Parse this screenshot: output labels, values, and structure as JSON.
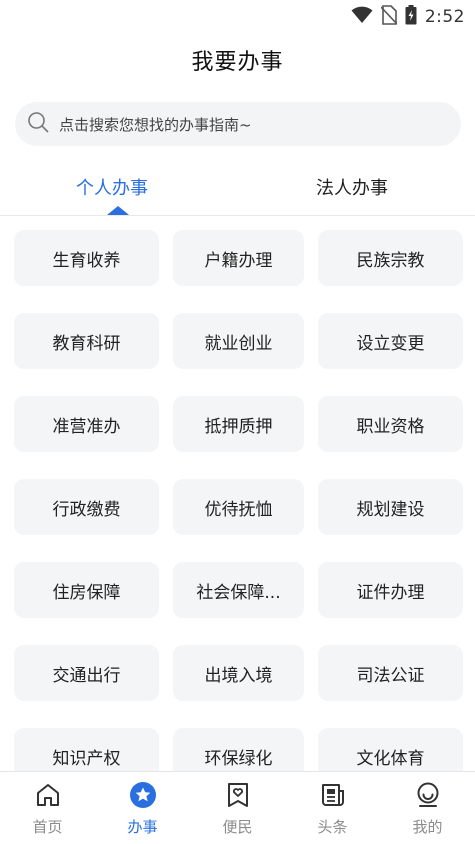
{
  "status_bar": {
    "time": "2:52"
  },
  "header": {
    "title": "我要办事"
  },
  "search": {
    "placeholder": "点击搜索您想找的办事指南~"
  },
  "tabs": [
    {
      "label": "个人办事",
      "active": true
    },
    {
      "label": "法人办事",
      "active": false
    }
  ],
  "services": [
    "生育收养",
    "户籍办理",
    "民族宗教",
    "教育科研",
    "就业创业",
    "设立变更",
    "准营准办",
    "抵押质押",
    "职业资格",
    "行政缴费",
    "优待抚恤",
    "规划建设",
    "住房保障",
    "社会保障...",
    "证件办理",
    "交通出行",
    "出境入境",
    "司法公证",
    "知识产权",
    "环保绿化",
    "文化体育"
  ],
  "bottom_nav": [
    {
      "label": "首页",
      "icon": "home-icon",
      "active": false
    },
    {
      "label": "办事",
      "icon": "star-icon",
      "active": true
    },
    {
      "label": "便民",
      "icon": "heart-bookmark-icon",
      "active": false
    },
    {
      "label": "头条",
      "icon": "news-icon",
      "active": false
    },
    {
      "label": "我的",
      "icon": "profile-icon",
      "active": false
    }
  ],
  "colors": {
    "accent": "#2a6fe0",
    "tile_bg": "#f4f5f7",
    "inactive_nav": "#8c8c8c"
  }
}
